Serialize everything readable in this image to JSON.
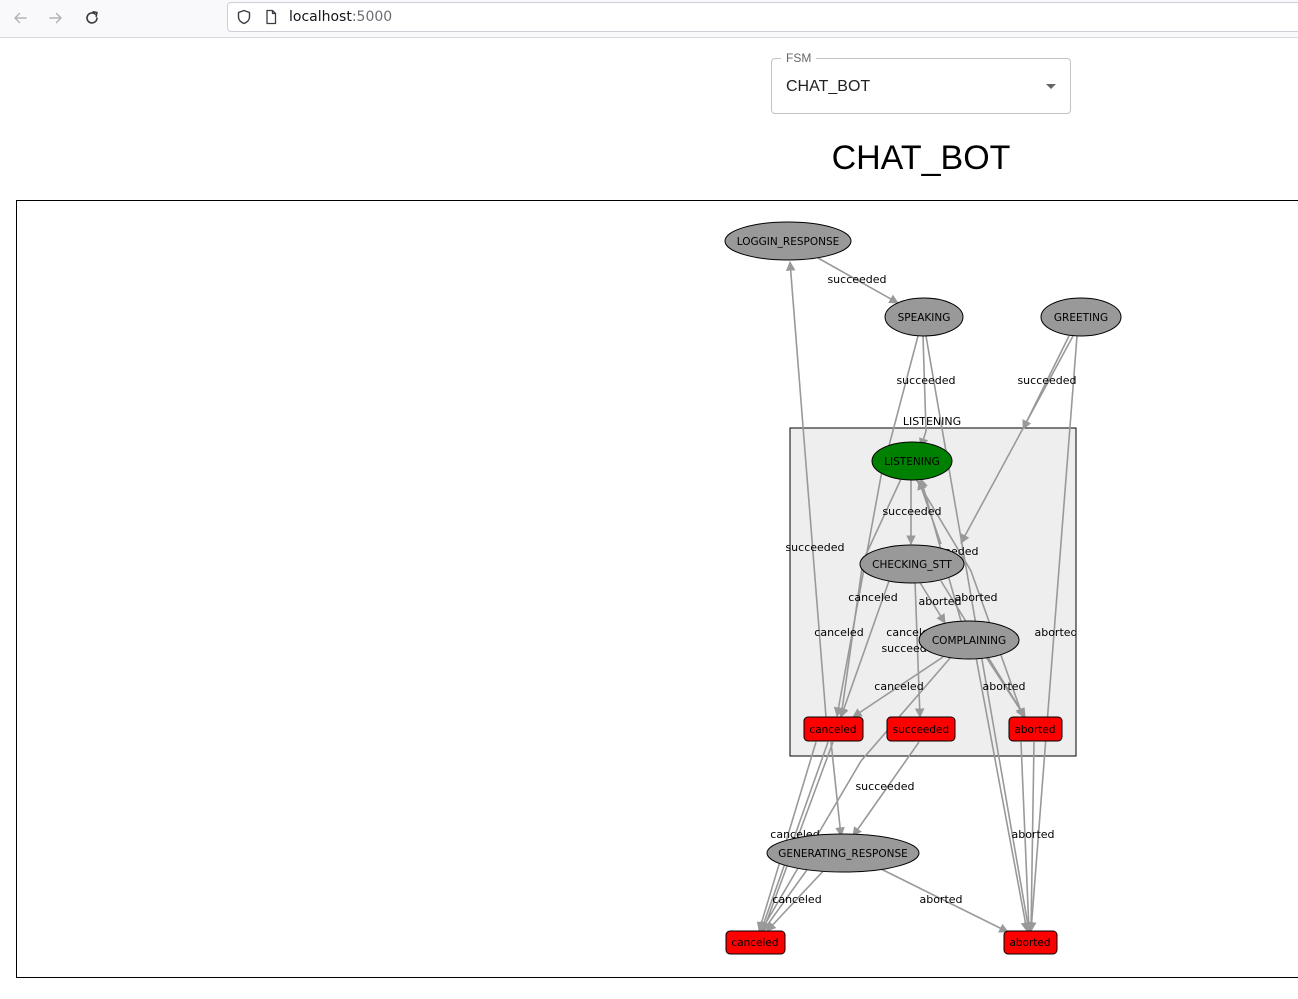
{
  "browser": {
    "url_host": "localhost",
    "url_port": ":5000"
  },
  "fsm_select": {
    "legend": "FSM",
    "value": "CHAT_BOT"
  },
  "page": {
    "title": "CHAT_BOT"
  },
  "colors": {
    "state_fill": "#999999",
    "active_state_fill": "#008000",
    "outcome_fill": "#ff0000",
    "container_fill": "#eeeeee",
    "edge": "#999999"
  },
  "graph": {
    "container": {
      "label": "LISTENING"
    },
    "nodes": [
      {
        "id": "loggin_response",
        "label": "LOGGIN_RESPONSE",
        "kind": "state"
      },
      {
        "id": "speaking",
        "label": "SPEAKING",
        "kind": "state"
      },
      {
        "id": "greeting",
        "label": "GREETING",
        "kind": "state"
      },
      {
        "id": "listening",
        "label": "LISTENING",
        "kind": "active"
      },
      {
        "id": "checking_stt",
        "label": "CHECKING_STT",
        "kind": "state"
      },
      {
        "id": "complaining",
        "label": "COMPLAINING",
        "kind": "state"
      },
      {
        "id": "inner_canceled",
        "label": "canceled",
        "kind": "outcome"
      },
      {
        "id": "inner_succeeded",
        "label": "succeeded",
        "kind": "outcome"
      },
      {
        "id": "inner_aborted",
        "label": "aborted",
        "kind": "outcome"
      },
      {
        "id": "generating_response",
        "label": "GENERATING_RESPONSE",
        "kind": "state"
      },
      {
        "id": "outer_canceled",
        "label": "canceled",
        "kind": "outcome"
      },
      {
        "id": "outer_aborted",
        "label": "aborted",
        "kind": "outcome"
      }
    ],
    "edges": [
      {
        "from": "loggin_response",
        "to": "speaking",
        "label": "succeeded"
      },
      {
        "from": "speaking",
        "to": "listening",
        "label": "succeeded"
      },
      {
        "from": "greeting",
        "to": "listening",
        "label": "succeeded"
      },
      {
        "from": "listening",
        "to": "checking_stt",
        "label": "succeeded"
      },
      {
        "from": "checking_stt",
        "to": "listening",
        "label": "succeeded"
      },
      {
        "from": "checking_stt",
        "to": "inner_canceled",
        "label": "canceled"
      },
      {
        "from": "checking_stt",
        "to": "complaining",
        "label": "aborted"
      },
      {
        "from": "listening",
        "to": "inner_aborted",
        "label": "aborted"
      },
      {
        "from": "listening",
        "to": "inner_canceled",
        "label": "canceled"
      },
      {
        "from": "complaining",
        "to": "inner_succeeded",
        "label": "succeeded"
      },
      {
        "from": "complaining",
        "to": "inner_canceled",
        "label": "canceled"
      },
      {
        "from": "complaining",
        "to": "inner_aborted",
        "label": "aborted"
      },
      {
        "from": "inner_canceled",
        "to": "loggin_response",
        "label": "succeeded"
      },
      {
        "from": "inner_succeeded",
        "to": "generating_response",
        "label": "succeeded"
      },
      {
        "from": "inner_canceled",
        "to": "outer_canceled",
        "label": "canceled"
      },
      {
        "from": "inner_aborted",
        "to": "outer_aborted",
        "label": "aborted"
      },
      {
        "from": "generating_response",
        "to": "outer_canceled",
        "label": "canceled"
      },
      {
        "from": "generating_response",
        "to": "outer_aborted",
        "label": "aborted"
      },
      {
        "from": "speaking",
        "to": "outer_aborted",
        "label": "aborted"
      },
      {
        "from": "greeting",
        "to": "outer_aborted",
        "label": "aborted"
      }
    ],
    "extra_edge_labels": [
      "succeeded",
      "succeeded",
      "succeeded",
      "canceled",
      "canceled",
      "aborted",
      "canceled",
      "canceled"
    ]
  }
}
